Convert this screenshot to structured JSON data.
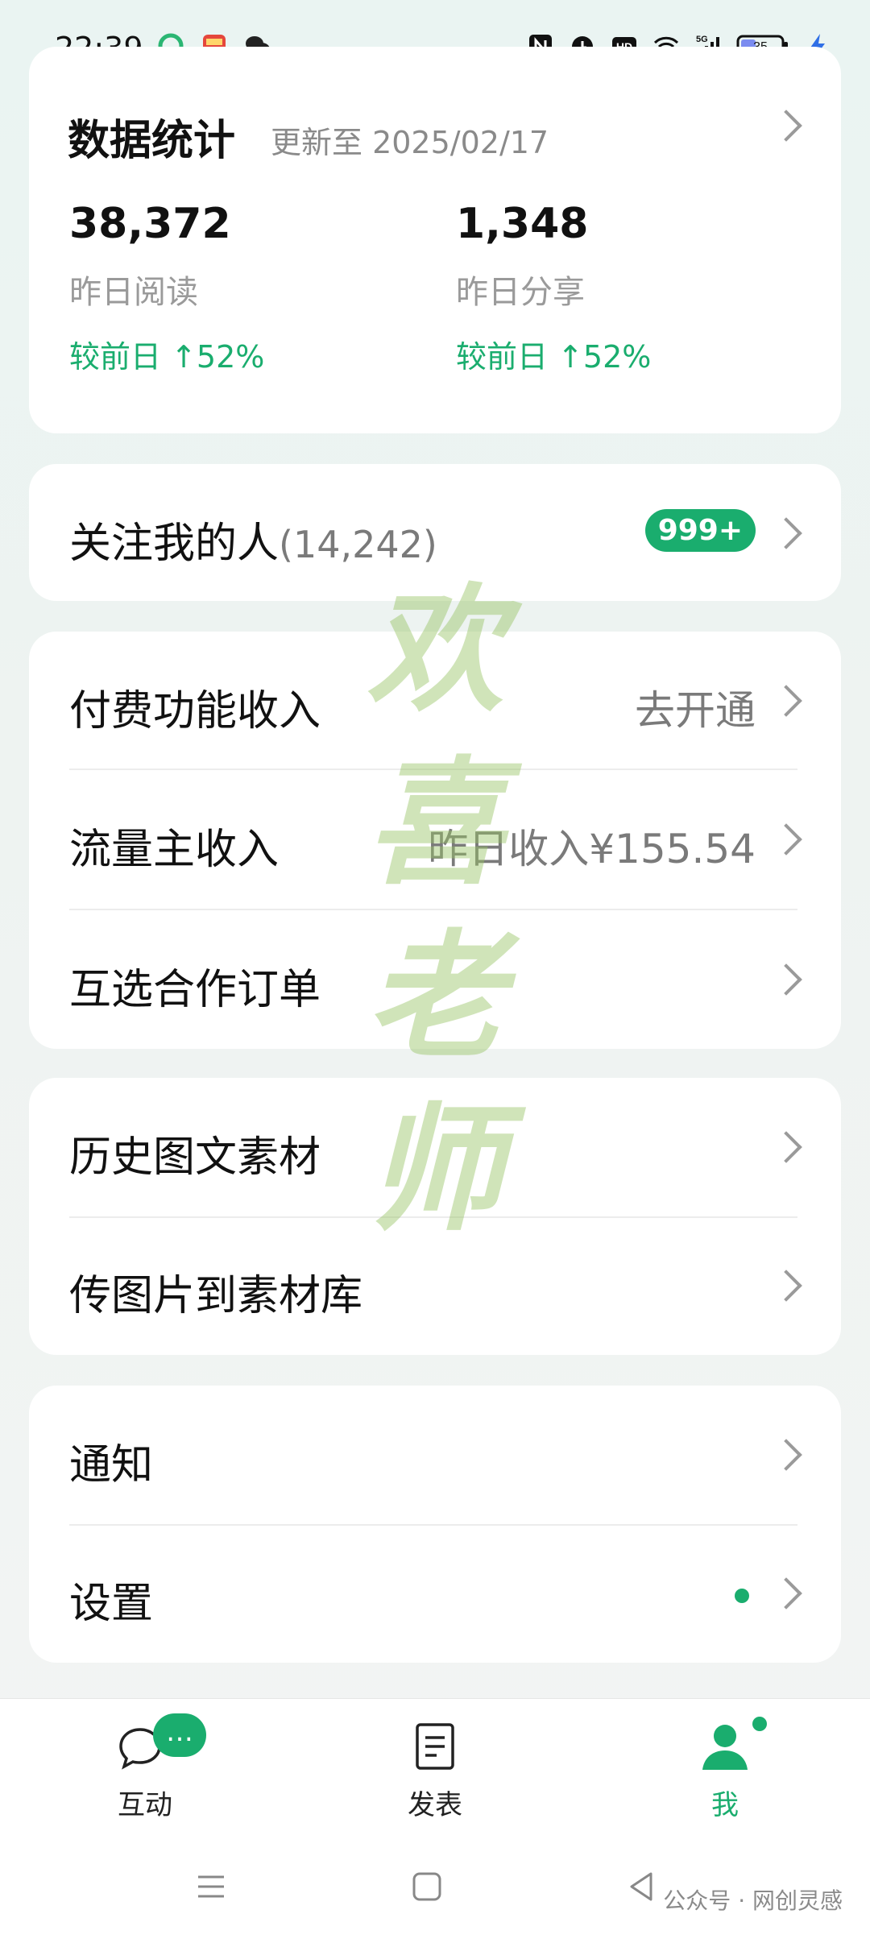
{
  "status_bar": {
    "time": "22:39",
    "battery": "35",
    "icons_left": [
      "app-icon-green",
      "app-icon-red",
      "wechat-icon"
    ],
    "icons_right": [
      "nfc-icon",
      "alarm-icon",
      "hd-icon",
      "wifi-icon",
      "5g-signal-icon",
      "battery-icon",
      "charging-icon"
    ]
  },
  "stats": {
    "title": "数据统计",
    "updated": "更新至 2025/02/17",
    "reads": {
      "value": "38,372",
      "label": "昨日阅读",
      "change": "较前日 ↑52%"
    },
    "shares": {
      "value": "1,348",
      "label": "昨日分享",
      "change": "较前日 ↑52%"
    }
  },
  "followers": {
    "label": "关注我的人",
    "count": "(14,242)",
    "badge": "999+"
  },
  "income": {
    "paid_label": "付费功能收入",
    "paid_value": "去开通",
    "traffic_label": "流量主收入",
    "traffic_value": "昨日收入¥155.54",
    "orders_label": "互选合作订单"
  },
  "material": {
    "history_label": "历史图文素材",
    "upload_label": "传图片到素材库"
  },
  "misc": {
    "notify_label": "通知",
    "settings_label": "设置"
  },
  "watermark": [
    "欢",
    "喜",
    "老",
    "师"
  ],
  "tabbar": {
    "tabs": [
      {
        "label": "互动"
      },
      {
        "label": "发表"
      },
      {
        "label": "我"
      }
    ],
    "bubble_text": "…"
  },
  "footer_watermark": "公众号 · 网创灵感",
  "colors": {
    "accent": "#1aad6e",
    "watermark": "#96c364"
  }
}
